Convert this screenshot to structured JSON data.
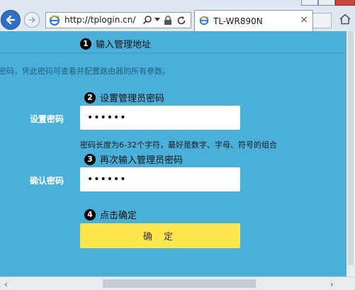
{
  "browser": {
    "url": "http://tplogin.cn/",
    "tab_title": "TL-WR890N",
    "tab_close": "×",
    "icons": [
      "back-arrow-icon",
      "forward-arrow-icon",
      "ie-logo-icon",
      "search-icon",
      "dropdown-icon",
      "lock-icon",
      "refresh-icon",
      "tab-favicon",
      "home-icon"
    ],
    "accent_color": "#2f6fc4"
  },
  "setup": {
    "background_color": "#4bb0d9",
    "button_color": "#ffe74d",
    "step1": {
      "number": "1",
      "text": "输入管理地址"
    },
    "intro": "密码，凭此密码可查看并配置路由器的所有参数。",
    "step2": {
      "number": "2",
      "text": "设置管理员密码"
    },
    "password": {
      "label": "设置密码",
      "value": "••••••"
    },
    "hint": "密码长度为6-32个字符，最好是数字、字母、符号的组合",
    "step3": {
      "number": "3",
      "text": "再次输入管理员密码"
    },
    "confirm": {
      "label": "确认密码",
      "value": "••••••"
    },
    "step4": {
      "number": "4",
      "text": "点击确定"
    },
    "submit_label": "确 定"
  },
  "scrollbar": {
    "left_arrow": "‹",
    "right_arrow": "›"
  }
}
